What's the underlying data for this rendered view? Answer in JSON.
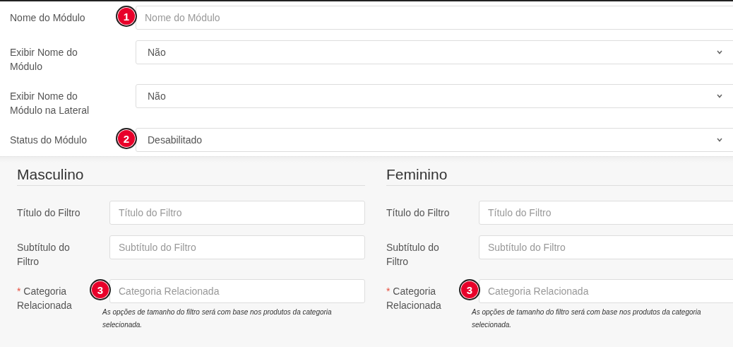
{
  "module_fields": [
    {
      "label": "Nome do Módulo",
      "kind": "text",
      "placeholder": "Nome do Módulo",
      "badge": "1"
    },
    {
      "label": "Exibir Nome do Módulo",
      "kind": "select",
      "value": "Não"
    },
    {
      "label": "Exibir Nome do Módulo na Lateral",
      "kind": "select",
      "value": "Não"
    },
    {
      "label": "Status do Módulo",
      "kind": "select",
      "value": "Desabilitado",
      "badge": "2"
    }
  ],
  "sections": [
    {
      "title": "Masculino",
      "fields": [
        {
          "label": "Título do Filtro",
          "placeholder": "Título do Filtro"
        },
        {
          "label": "Subtítulo do Filtro",
          "placeholder": "Subtítulo do Filtro"
        },
        {
          "label": "Categoria Relacionada",
          "required_mark": "*",
          "placeholder": "Categoria Relacionada",
          "badge": "3",
          "help": " As opções de tamanho do filtro será com base nos produtos da categoria selecionada."
        }
      ]
    },
    {
      "title": "Feminino",
      "fields": [
        {
          "label": "Título do Filtro",
          "placeholder": "Título do Filtro"
        },
        {
          "label": "Subtítulo do Filtro",
          "placeholder": "Subtítulo do Filtro"
        },
        {
          "label": "Categoria Relacionada",
          "required_mark": "*",
          "placeholder": "Categoria Relacionada",
          "badge": "3",
          "help": " As opções de tamanho do filtro será com base nos produtos da categoria selecionada."
        }
      ]
    }
  ]
}
